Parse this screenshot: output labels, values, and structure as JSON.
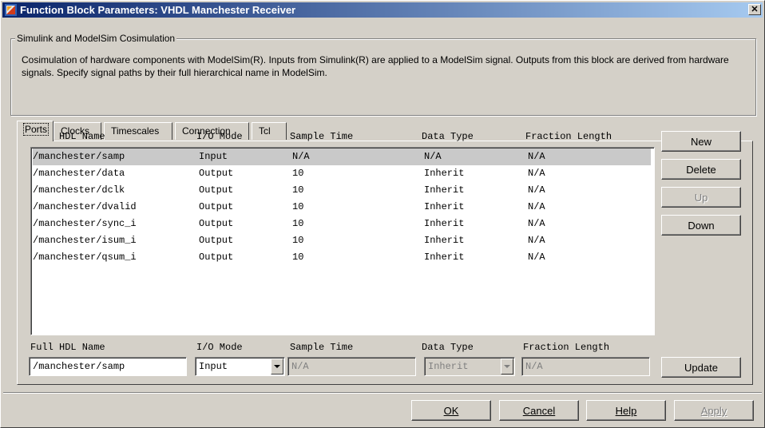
{
  "window": {
    "title": "Function Block Parameters: VHDL Manchester Receiver",
    "close_label": "✕"
  },
  "group": {
    "label": "Simulink and ModelSim Cosimulation",
    "description": "Cosimulation of hardware components with ModelSim(R). Inputs from Simulink(R) are applied to a ModelSim signal. Outputs from this block are derived from hardware signals. Specify signal paths by their full hierarchical name in ModelSim."
  },
  "tabs": [
    "Ports",
    "Clocks",
    "Timescales",
    "Connection",
    "Tcl"
  ],
  "active_tab": "Ports",
  "table": {
    "headers": [
      "Full HDL Name",
      "I/O Mode",
      "Sample Time",
      "Data Type",
      "Fraction Length"
    ],
    "rows": [
      [
        "/manchester/samp",
        "Input",
        "N/A",
        "N/A",
        "N/A"
      ],
      [
        "/manchester/data",
        "Output",
        "10",
        "Inherit",
        "N/A"
      ],
      [
        "/manchester/dclk",
        "Output",
        "10",
        "Inherit",
        "N/A"
      ],
      [
        "/manchester/dvalid",
        "Output",
        "10",
        "Inherit",
        "N/A"
      ],
      [
        "/manchester/sync_i",
        "Output",
        "10",
        "Inherit",
        "N/A"
      ],
      [
        "/manchester/isum_i",
        "Output",
        "10",
        "Inherit",
        "N/A"
      ],
      [
        "/manchester/qsum_i",
        "Output",
        "10",
        "Inherit",
        "N/A"
      ]
    ],
    "selected_row": 0
  },
  "side_buttons": {
    "new": "New",
    "delete": "Delete",
    "up": "Up",
    "down": "Down",
    "update": "Update"
  },
  "editor": {
    "headers": [
      "Full HDL Name",
      "I/O Mode",
      "Sample Time",
      "Data Type",
      "Fraction Length"
    ],
    "full_hdl_name": "/manchester/samp",
    "io_mode": "Input",
    "sample_time": "N/A",
    "data_type": "Inherit",
    "fraction_length": "N/A"
  },
  "footer": {
    "ok": "OK",
    "cancel": "Cancel",
    "help": "Help",
    "apply": "Apply"
  }
}
